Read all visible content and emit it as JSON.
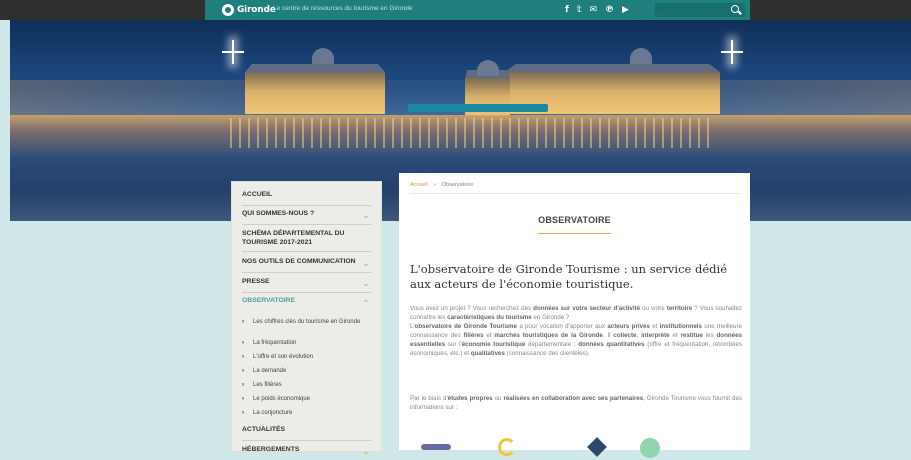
{
  "header": {
    "logo_text": "Gironde",
    "tagline": "Le centre de ressources du tourisme en Gironde",
    "social": [
      {
        "name": "facebook-icon",
        "glyph": "f"
      },
      {
        "name": "twitter-icon",
        "glyph": "𝕥"
      },
      {
        "name": "mail-icon",
        "glyph": "✉"
      },
      {
        "name": "pinterest-icon",
        "glyph": "℗"
      },
      {
        "name": "youtube-icon",
        "glyph": "▶"
      }
    ],
    "search_placeholder": "...",
    "colors": {
      "topbar": "#2e2f2f",
      "brand": "#1e7f7c"
    }
  },
  "sidebar": {
    "items": [
      {
        "label": "ACCUEIL"
      },
      {
        "label": "QUI SOMMES-NOUS ?"
      },
      {
        "label": "SCHÉMA DÉPARTEMENTAL DU TOURISME 2017-2021"
      },
      {
        "label": "NOS OUTILS DE COMMUNICATION"
      },
      {
        "label": "PRESSE"
      },
      {
        "label": "OBSERVATOIRE"
      },
      {
        "label": "ACTUALITÉS"
      },
      {
        "label": "HÉBERGEMENTS"
      }
    ],
    "sub_items": [
      {
        "label": "Les chiffres clés du tourisme en Gironde"
      },
      {
        "label": "La fréquentation"
      },
      {
        "label": "L'offre et son évolution"
      },
      {
        "label": "La demande"
      },
      {
        "label": "Les filières"
      },
      {
        "label": "Le poids économique"
      },
      {
        "label": "La conjoncture"
      }
    ],
    "accent": "#4aa398"
  },
  "main": {
    "breadcrumb": {
      "home": "Accueil",
      "separator": "»",
      "current": "Observatoire"
    },
    "title": "OBSERVATOIRE",
    "headline": "L'observatoire de Gironde Tourisme : un service dédié aux acteurs de l'économie touristique.",
    "intro": {
      "p1_a": "Vous avez un projet ? Vous recherchez des ",
      "p1_b": "données sur votre secteur d'activité",
      "p1_c": " ou votre ",
      "p1_d": "territoire",
      "p1_e": " ? Vous souhaitez connaître les ",
      "p1_f": "caractéristiques du tourisme",
      "p1_g": " en Gironde ?",
      "p2_a": "L'",
      "p2_b": "observatoire de Gironde Tourisme",
      "p2_c": " a pour vocation d'apporter aux ",
      "p2_d": "acteurs privés",
      "p2_e": " et ",
      "p2_f": "institutionnels",
      "p2_g": " une meilleure connaissance des ",
      "p2_h": "filières",
      "p2_i": " et ",
      "p2_j": "marchés touristiques de la Gironde",
      "p2_k": ". Il ",
      "p2_l": "collecte",
      "p2_m": ", ",
      "p2_n": "interprète",
      "p2_o": " et ",
      "p2_p": "restitue",
      "p2_q": " les ",
      "p2_r": "données essentielles",
      "p2_s": " sur l'",
      "p2_t": "économie touristique",
      "p2_u": " départementale : ",
      "p2_v": "données quantitatives",
      "p2_w": " (offre et fréquentation, retombées économiques, etc.) et ",
      "p2_x": "qualitatives",
      "p2_y": " (connaissance des clientèles)."
    },
    "para3": {
      "a": "Par le biais d'",
      "b": "études propres",
      "c": " ou ",
      "d": "réalisées en collaboration avec ses partenaires",
      "e": ", Gironde Tourisme vous fournit des informations sur :"
    }
  }
}
